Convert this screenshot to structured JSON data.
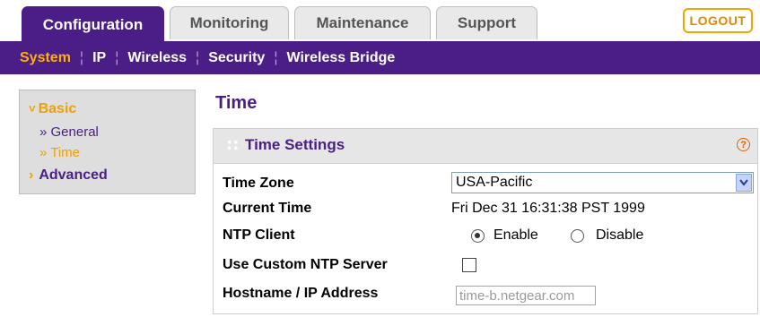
{
  "tabs": [
    {
      "label": "Configuration",
      "active": true
    },
    {
      "label": "Monitoring",
      "active": false
    },
    {
      "label": "Maintenance",
      "active": false
    },
    {
      "label": "Support",
      "active": false
    }
  ],
  "logout_label": "LOGOUT",
  "subnav": [
    {
      "label": "System",
      "active": true
    },
    {
      "label": "IP",
      "active": false
    },
    {
      "label": "Wireless",
      "active": false
    },
    {
      "label": "Security",
      "active": false
    },
    {
      "label": "Wireless Bridge",
      "active": false
    }
  ],
  "sidemenu": {
    "basic": {
      "label": "Basic",
      "expand_glyph": "˅"
    },
    "general": {
      "label": "» General"
    },
    "time": {
      "label": "» Time"
    },
    "advanced": {
      "label": "Advanced",
      "expand_glyph": "›"
    }
  },
  "page_title": "Time",
  "panel": {
    "title": "Time Settings",
    "grip_glyph": "::",
    "help_glyph": "?",
    "time_zone": {
      "label": "Time Zone",
      "value": "USA-Pacific"
    },
    "current_time": {
      "label": "Current Time",
      "value": "Fri Dec 31 16:31:38 PST 1999"
    },
    "ntp_client": {
      "label": "NTP Client",
      "enable_label": "Enable",
      "disable_label": "Disable",
      "selected": "Enable"
    },
    "custom_ntp": {
      "label": "Use Custom NTP Server",
      "checked": false
    },
    "hostname": {
      "label": "Hostname / IP Address",
      "value": "time-b.netgear.com"
    }
  },
  "colors": {
    "brand_purple": "#4a1e86",
    "accent_orange": "#ffb000",
    "side_menu_bg": "#dedede"
  },
  "icons": {
    "help": "help-icon",
    "dropdown": "chevron-down-icon",
    "expand": "chevron-right-icon"
  }
}
